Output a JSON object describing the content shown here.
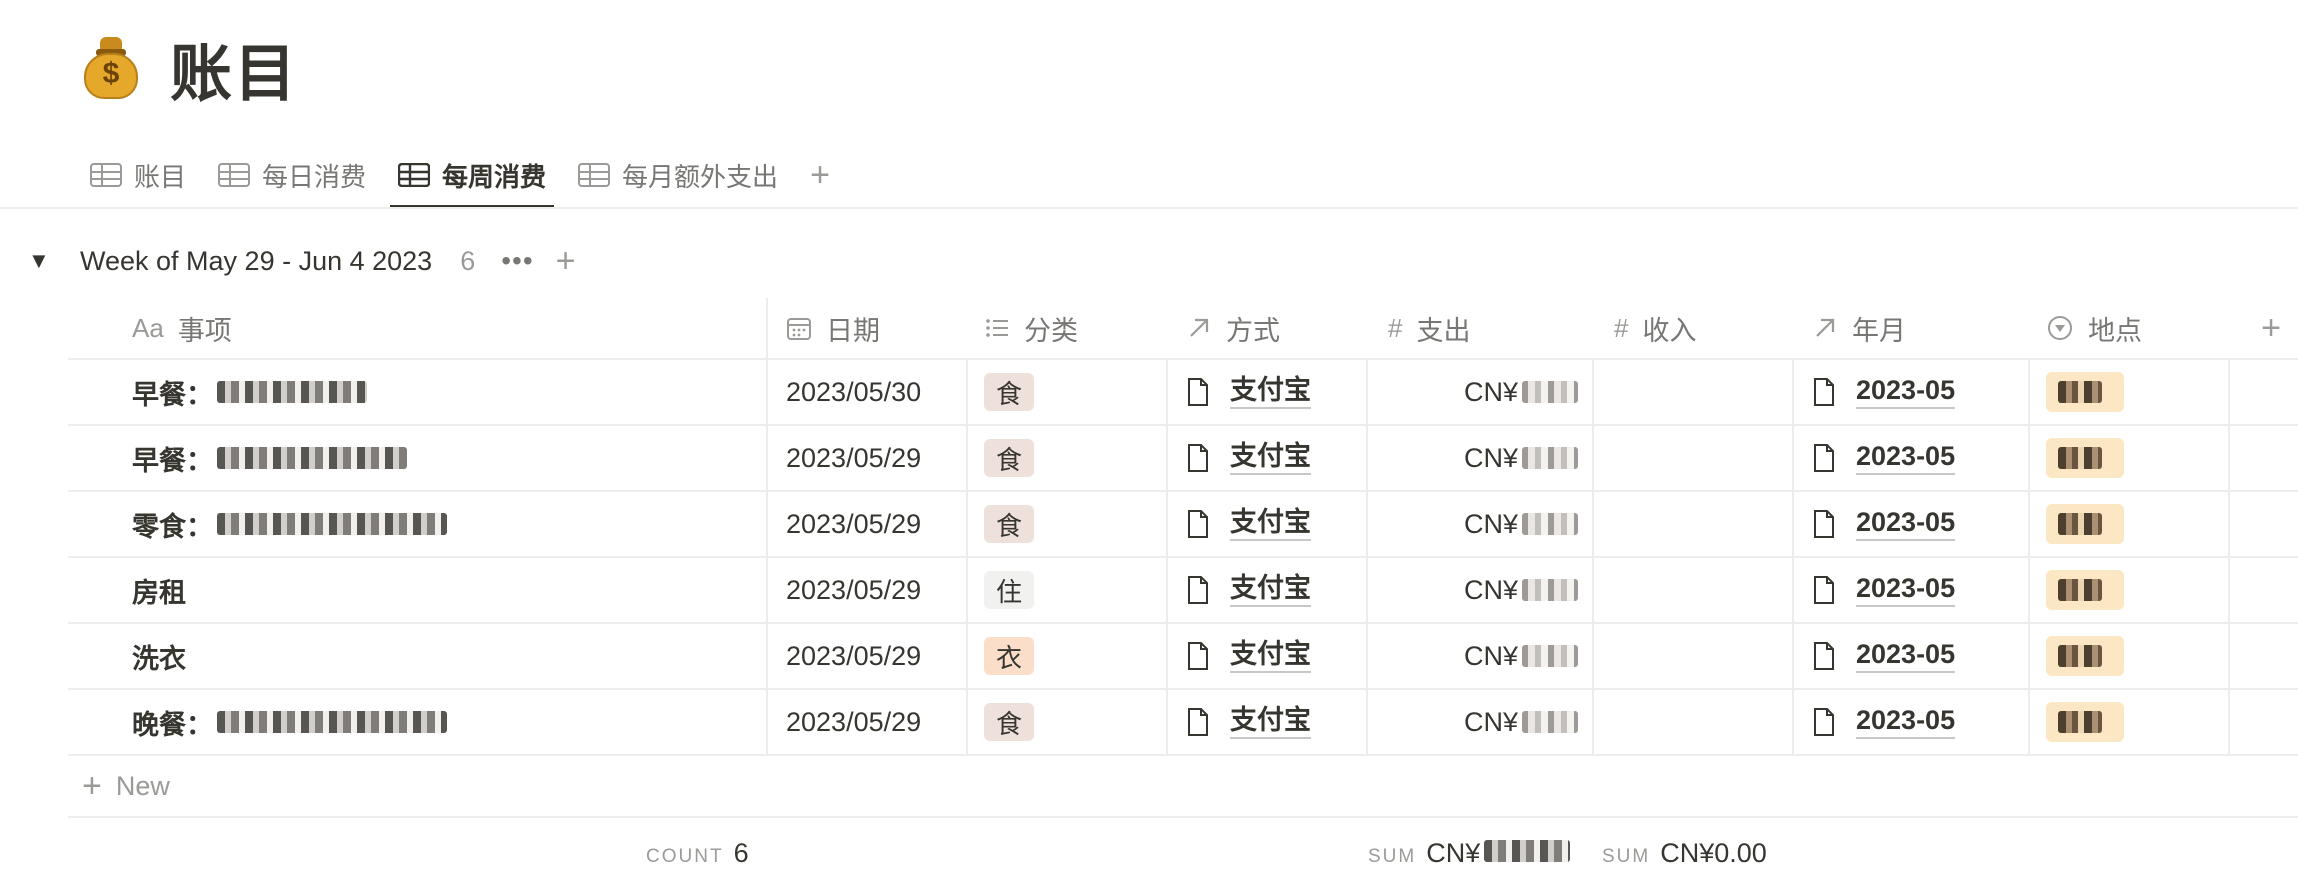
{
  "page": {
    "title": "账目",
    "icon": "money-bag-icon"
  },
  "tabs": [
    {
      "label": "账目",
      "active": false
    },
    {
      "label": "每日消费",
      "active": false
    },
    {
      "label": "每周消费",
      "active": true
    },
    {
      "label": "每月额外支出",
      "active": false
    }
  ],
  "tabs_add": "+",
  "group": {
    "title": "Week of May 29 - Jun 4 2023",
    "count": "6",
    "more": "•••",
    "add": "+"
  },
  "columns": {
    "name": {
      "icon": "Aa",
      "label": "事项"
    },
    "date": {
      "icon": "calendar-icon",
      "label": "日期"
    },
    "category": {
      "icon": "list-icon",
      "label": "分类"
    },
    "method": {
      "icon": "relation-arrow-icon",
      "label": "方式"
    },
    "expense": {
      "icon": "#",
      "label": "支出"
    },
    "income": {
      "icon": "#",
      "label": "收入"
    },
    "yearmonth": {
      "icon": "relation-arrow-icon",
      "label": "年月"
    },
    "location": {
      "icon": "select-icon",
      "label": "地点"
    },
    "add": "+"
  },
  "rows": [
    {
      "name": "早餐：",
      "name_redacted": true,
      "date": "2023/05/30",
      "category": "食",
      "category_color": "#eee0da",
      "method": "支付宝",
      "expense": "CN¥",
      "yearmonth": "2023-05"
    },
    {
      "name": "早餐：",
      "name_redacted": true,
      "date": "2023/05/29",
      "category": "食",
      "category_color": "#eee0da",
      "method": "支付宝",
      "expense": "CN¥",
      "yearmonth": "2023-05"
    },
    {
      "name": "零食：",
      "name_redacted": true,
      "date": "2023/05/29",
      "category": "食",
      "category_color": "#eee0da",
      "method": "支付宝",
      "expense": "CN¥",
      "yearmonth": "2023-05"
    },
    {
      "name": "房租",
      "name_redacted": false,
      "date": "2023/05/29",
      "category": "住",
      "category_color": "#f1f1ef",
      "method": "支付宝",
      "expense": "CN¥",
      "yearmonth": "2023-05"
    },
    {
      "name": "洗衣",
      "name_redacted": false,
      "date": "2023/05/29",
      "category": "衣",
      "category_color": "#fadec9",
      "method": "支付宝",
      "expense": "CN¥",
      "yearmonth": "2023-05"
    },
    {
      "name": "晚餐：",
      "name_redacted": true,
      "date": "2023/05/29",
      "category": "食",
      "category_color": "#eee0da",
      "method": "支付宝",
      "expense": "CN¥",
      "yearmonth": "2023-05"
    }
  ],
  "new_row": {
    "plus": "+",
    "label": "New"
  },
  "footer": {
    "count_label": "COUNT",
    "count_value": "6",
    "expense_sum_label": "SUM",
    "expense_sum_value": "CN¥",
    "income_sum_label": "SUM",
    "income_sum_value": "CN¥0.00"
  },
  "colors": {
    "text": "#37352f",
    "muted": "#9b9a97",
    "border": "#ededec",
    "location_chip": "#fbe7c4"
  }
}
